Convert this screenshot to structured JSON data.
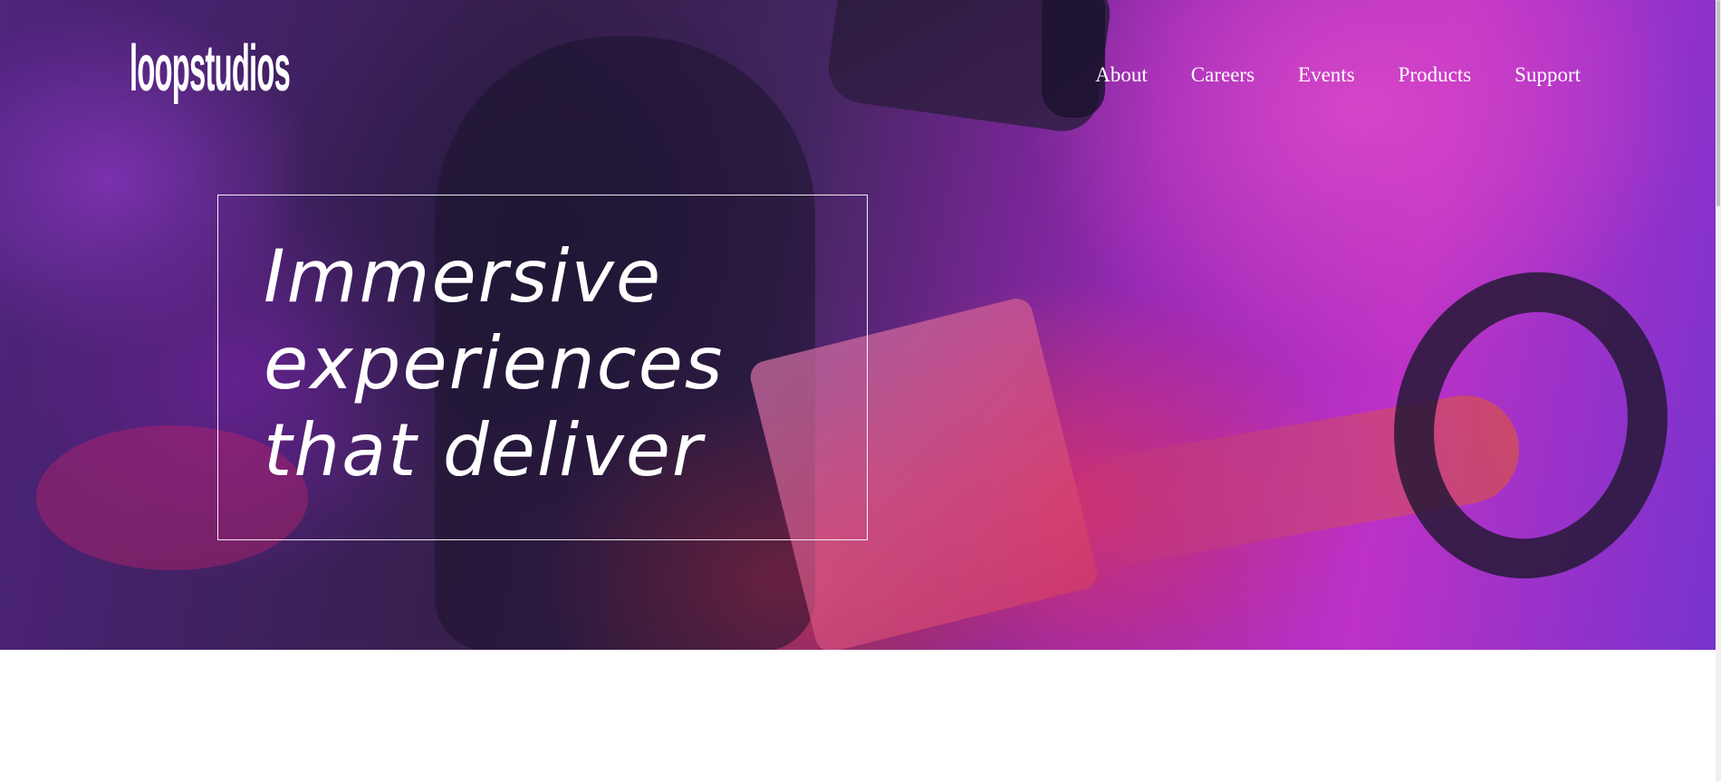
{
  "brand": {
    "logo_text": "loopstudios"
  },
  "nav": {
    "items": [
      "About",
      "Careers",
      "Events",
      "Products",
      "Support"
    ]
  },
  "hero": {
    "headline_lines": [
      "Immersive",
      "experiences",
      "that deliver"
    ]
  },
  "colors": {
    "text": "#ffffff",
    "page_background": "#ffffff",
    "hero_magenta": "#e13ae8",
    "hero_pink": "#ff3c78",
    "hero_dark": "#3d2456"
  }
}
